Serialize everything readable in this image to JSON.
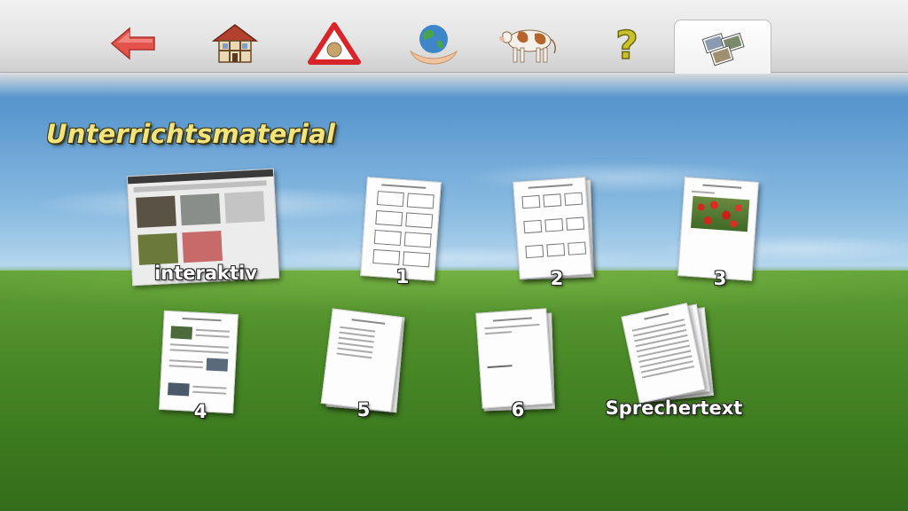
{
  "toolbar": {
    "buttons": [
      {
        "name": "back-arrow-icon",
        "label": "back"
      },
      {
        "name": "house-icon",
        "label": "home"
      },
      {
        "name": "warning-sign-icon",
        "label": "warning"
      },
      {
        "name": "globe-in-hands-icon",
        "label": "world"
      },
      {
        "name": "cow-icon",
        "label": "animals"
      },
      {
        "name": "question-mark-icon",
        "label": "help"
      },
      {
        "name": "pictures-icon",
        "label": "materials"
      }
    ],
    "active": "pictures-icon",
    "colors": {
      "arrow": "#e0504a",
      "question": "#c9c22a",
      "bar": "#e3e3e3"
    }
  },
  "page_title": "Unterrichtsmaterial",
  "documents": [
    {
      "id": "interaktiv",
      "label": "interaktiv"
    },
    {
      "id": "doc1",
      "label": "1"
    },
    {
      "id": "doc2",
      "label": "2"
    },
    {
      "id": "doc3",
      "label": "3"
    },
    {
      "id": "doc4",
      "label": "4"
    },
    {
      "id": "doc5",
      "label": "5"
    },
    {
      "id": "doc6",
      "label": "6"
    },
    {
      "id": "sprechertext",
      "label": "Sprechertext"
    }
  ]
}
